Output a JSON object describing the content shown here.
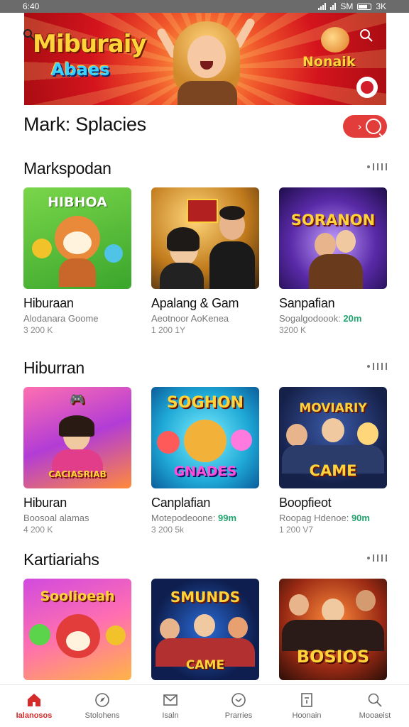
{
  "status_bar": {
    "time": "6:40",
    "right_text": "SM",
    "battery_text": "3K"
  },
  "banner": {
    "title": "Miburaiy",
    "subtitle": "Abaes",
    "logo2": "Nonaik"
  },
  "page": {
    "title": "Mark: Splacies"
  },
  "sections": [
    {
      "title": "Markspodan",
      "cards": [
        {
          "name": "Hiburaan",
          "meta": "Alodanara Goome",
          "meta_extra": "",
          "count": "3 200 K",
          "thumb_label": "HIBHOA"
        },
        {
          "name": "Apalang & Gam",
          "meta": "Aeotnoor AoKenea",
          "meta_extra": "",
          "count": "1 200 1Y",
          "thumb_label": ""
        },
        {
          "name": "Sanpafian",
          "meta": "Sogalgodoook:",
          "meta_extra": "20m",
          "count": "3200 K",
          "thumb_label": "SORANON"
        }
      ]
    },
    {
      "title": "Hiburran",
      "cards": [
        {
          "name": "Hiburan",
          "meta": "Boosoal alamas",
          "meta_extra": "",
          "count": "4 200 K",
          "thumb_label": "CACIASRIAB"
        },
        {
          "name": "Canplafian",
          "meta": "Motepodeoone:",
          "meta_extra": "99m",
          "count": "3 200 5k",
          "thumb_label": "GNADES"
        },
        {
          "name": "Boopfieot",
          "meta": "Roopag Hdenoe:",
          "meta_extra": "90m",
          "count": "1 200 V7",
          "thumb_label": "CAME"
        }
      ]
    },
    {
      "title": "Kartiariahs",
      "cards": [
        {
          "name": "",
          "meta": "",
          "meta_extra": "",
          "count": "",
          "thumb_label": "Soolioeah"
        },
        {
          "name": "",
          "meta": "",
          "meta_extra": "",
          "count": "",
          "thumb_label": "CAME"
        },
        {
          "name": "",
          "meta": "",
          "meta_extra": "",
          "count": "",
          "thumb_label": "BOSIOS"
        }
      ]
    }
  ],
  "nav": [
    {
      "label": "Ialanosos",
      "icon": "home-icon",
      "active": true
    },
    {
      "label": "Stolohens",
      "icon": "compass-icon",
      "active": false
    },
    {
      "label": "Isaln",
      "icon": "mail-icon",
      "active": false
    },
    {
      "label": "Prarries",
      "icon": "clock-icon",
      "active": false
    },
    {
      "label": "Hoonain",
      "icon": "document-icon",
      "active": false
    },
    {
      "label": "Mooaeist",
      "icon": "search-icon",
      "active": false
    }
  ],
  "colors": {
    "accent": "#d62b2b",
    "pill": "#e23d3b",
    "green": "#21a36e"
  }
}
